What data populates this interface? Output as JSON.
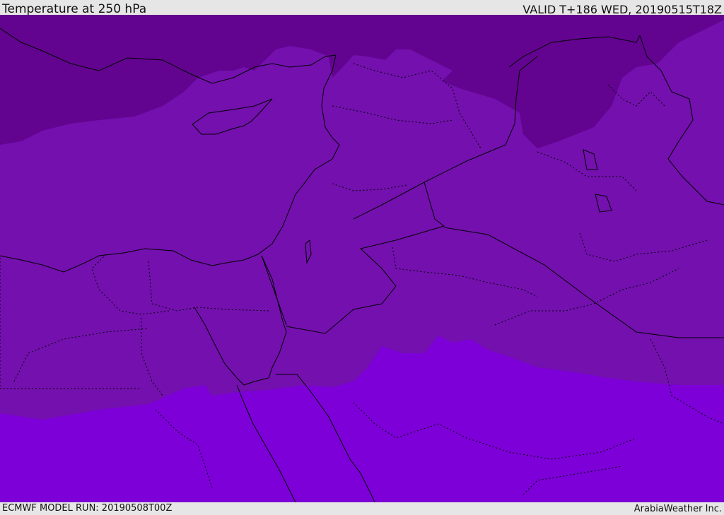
{
  "header": {
    "title": "Temperature at 250 hPa",
    "valid": "VALID T+186 WED, 20190515T18Z"
  },
  "footer": {
    "model_run": "ECMWF MODEL RUN: 20190508T00Z",
    "credit": "ArabiaWeather Inc."
  },
  "map": {
    "colors": {
      "band_dark": "#62048f",
      "band_mid": "#7310ae",
      "band_mid2": "#780db8",
      "band_light": "#7d00d8",
      "lines": "#000000"
    }
  }
}
